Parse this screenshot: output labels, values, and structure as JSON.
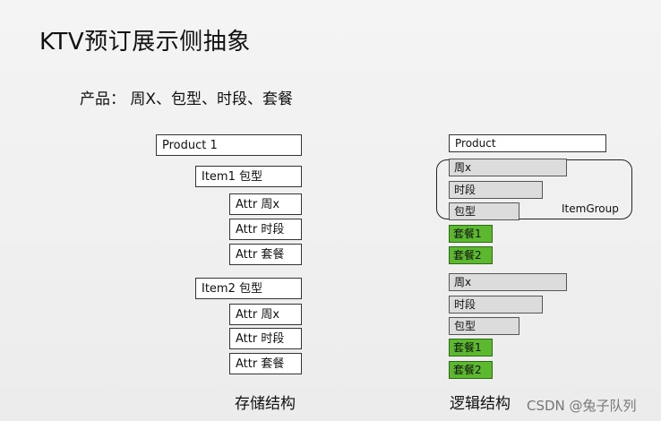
{
  "title": "KTV预订展示侧抽象",
  "products_line": "产品： 周X、包型、时段、套餐",
  "storage": {
    "product": "Product 1",
    "item1": "Item1  包型",
    "item1_attrs": [
      "Attr 周x",
      "Attr 时段",
      "Attr 套餐"
    ],
    "item2": "Item2  包型",
    "item2_attrs": [
      "Attr 周x",
      "Attr 时段",
      "Attr 套餐"
    ],
    "caption": "存储结构"
  },
  "logical": {
    "product": "Product",
    "group_items": [
      "周x",
      "时段",
      "包型"
    ],
    "group_label": "ItemGroup",
    "green_items_1": [
      "套餐1",
      "套餐2"
    ],
    "items_2": [
      "周x",
      "时段",
      "包型"
    ],
    "green_items_2": [
      "套餐1",
      "套餐2"
    ],
    "caption": "逻辑结构"
  },
  "colors": {
    "green_fill": "#5cb82e",
    "gray_fill": "#dcdcdc"
  },
  "watermark": "CSDN @兔子队列"
}
